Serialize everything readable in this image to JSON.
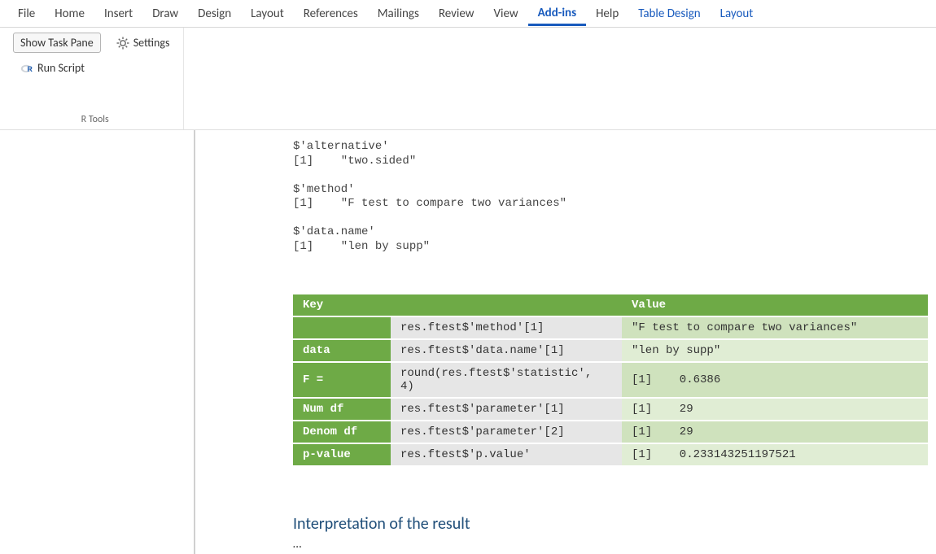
{
  "ribbon": {
    "tabs": [
      "File",
      "Home",
      "Insert",
      "Draw",
      "Design",
      "Layout",
      "References",
      "Mailings",
      "Review",
      "View",
      "Add-ins",
      "Help",
      "Table Design",
      "Layout"
    ],
    "active": "Add-ins",
    "group1": {
      "btn_show": "Show Task Pane",
      "btn_run": "Run Script",
      "btn_settings": "Settings",
      "label": "R Tools"
    }
  },
  "console": {
    "alt_key": "$'alternative'",
    "alt_val": "[1]    \"two.sided\"",
    "meth_key": "$'method'",
    "meth_val": "[1]    \"F test to compare two variances\"",
    "dn_key": "$'data.name'",
    "dn_val": "[1]    \"len by supp\""
  },
  "table": {
    "headers": {
      "key": "Key",
      "value": "Value"
    },
    "rows": [
      {
        "label": "",
        "code": "res.ftest$'method'[1]",
        "value": "\"F test to compare two variances\"",
        "val_shade": "d"
      },
      {
        "label": "data",
        "code": "res.ftest$'data.name'[1]",
        "value": "\"len by supp\"",
        "val_shade": "l"
      },
      {
        "label": "F =",
        "code": "round(res.ftest$'statistic', 4)",
        "value": "[1]    0.6386",
        "val_shade": "d"
      },
      {
        "label": "Num df",
        "code": "res.ftest$'parameter'[1]",
        "value": "[1]    29",
        "val_shade": "l"
      },
      {
        "label": "Denom df",
        "code": "res.ftest$'parameter'[2]",
        "value": "[1]    29",
        "val_shade": "d"
      },
      {
        "label": "p-value",
        "code": "res.ftest$'p.value'",
        "value": "[1]    0.233143251197521",
        "val_shade": "l"
      }
    ]
  },
  "doc": {
    "heading": "Interpretation of the result",
    "body": "…"
  }
}
